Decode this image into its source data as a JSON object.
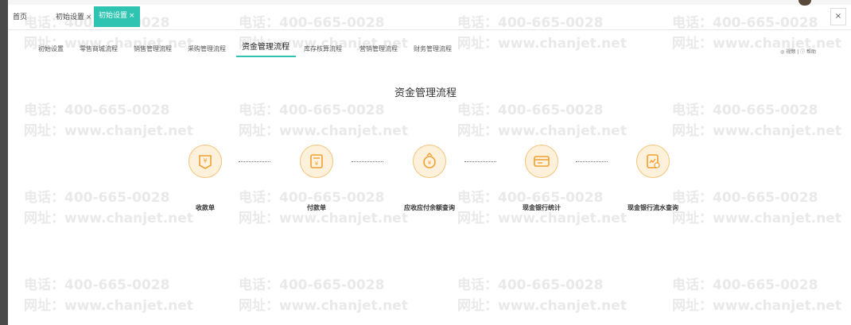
{
  "tabs": [
    {
      "label": "首页",
      "closable": false
    },
    {
      "label": "初始设置",
      "closable": true
    },
    {
      "label": "初始设置",
      "closable": true,
      "active": true
    }
  ],
  "tab_close_glyph": "×",
  "window_close_glyph": "×",
  "subnav": {
    "items": [
      "初始设置",
      "零售商城流程",
      "销售管理流程",
      "采购管理流程",
      "资金管理流程",
      "库存核算流程",
      "营销管理流程",
      "财务管理流程"
    ],
    "active_index": 4,
    "help_text": "◎ 视频 | ⓘ 帮助"
  },
  "page_title": "资金管理流程",
  "steps": [
    {
      "label": "收款单",
      "icon": "receipt-yen-icon"
    },
    {
      "label": "付款单",
      "icon": "payment-yen-icon"
    },
    {
      "label": "应收应付余额查询",
      "icon": "balance-query-icon"
    },
    {
      "label": "现金银行统计",
      "icon": "bank-card-icon"
    },
    {
      "label": "现金银行流水查询",
      "icon": "cash-flow-query-icon"
    }
  ],
  "watermark": {
    "phone": "电话：400-665-0028",
    "site": "网址：www.chanjet.net"
  },
  "colors": {
    "accent": "#2fc4b2",
    "icon_fill": "#fdf1db",
    "icon_stroke": "#f0a030"
  }
}
